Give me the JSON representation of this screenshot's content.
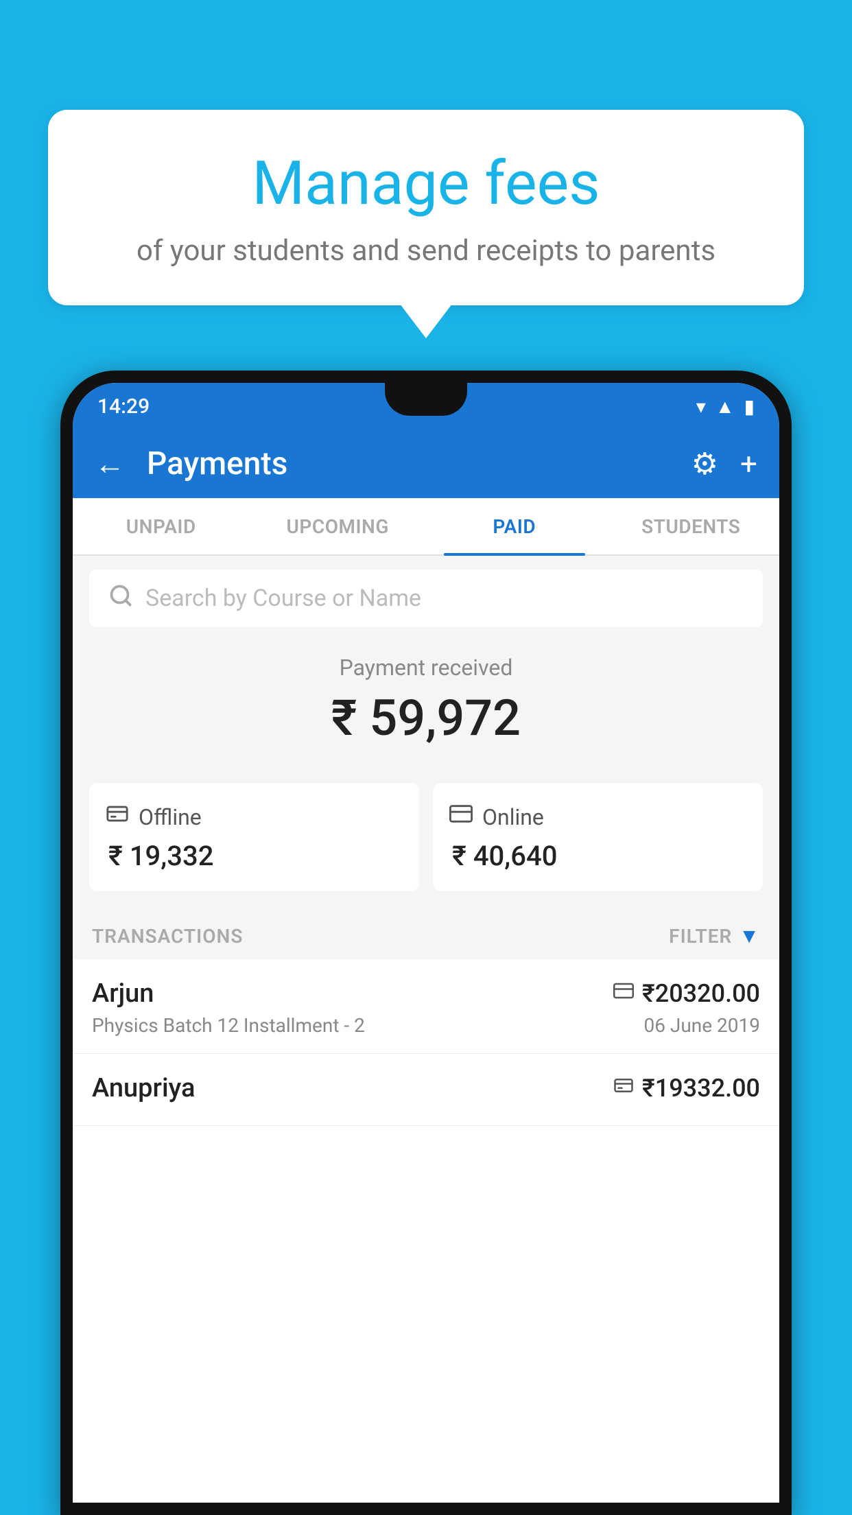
{
  "background_color": "#1ab3e8",
  "bubble": {
    "title": "Manage fees",
    "subtitle": "of your students and send receipts to parents"
  },
  "status_bar": {
    "time": "14:29",
    "icons": [
      "wifi",
      "signal",
      "battery"
    ]
  },
  "app_bar": {
    "title": "Payments",
    "back_label": "←",
    "settings_label": "⚙",
    "add_label": "+"
  },
  "tabs": [
    {
      "label": "UNPAID",
      "active": false
    },
    {
      "label": "UPCOMING",
      "active": false
    },
    {
      "label": "PAID",
      "active": true
    },
    {
      "label": "STUDENTS",
      "active": false
    }
  ],
  "search": {
    "placeholder": "Search by Course or Name"
  },
  "payment_summary": {
    "label": "Payment received",
    "amount": "₹ 59,972",
    "offline": {
      "type": "Offline",
      "amount": "₹ 19,332",
      "icon": "💳"
    },
    "online": {
      "type": "Online",
      "amount": "₹ 40,640",
      "icon": "💳"
    }
  },
  "transactions_section": {
    "label": "TRANSACTIONS",
    "filter_label": "FILTER"
  },
  "transactions": [
    {
      "name": "Arjun",
      "detail": "Physics Batch 12 Installment - 2",
      "amount": "₹20320.00",
      "date": "06 June 2019",
      "icon": "card"
    },
    {
      "name": "Anupriya",
      "detail": "",
      "amount": "₹19332.00",
      "date": "",
      "icon": "cash"
    }
  ]
}
